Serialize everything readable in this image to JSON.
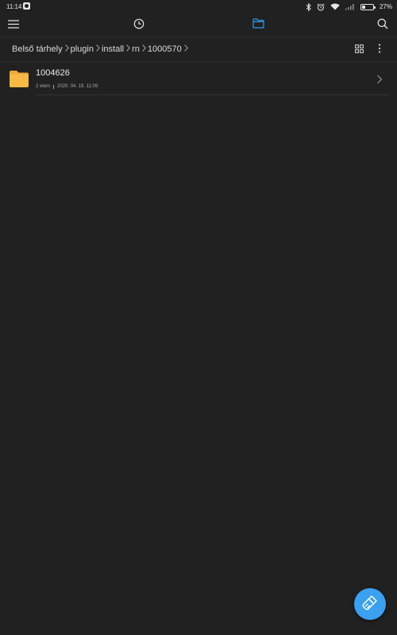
{
  "status_bar": {
    "time": "11:14",
    "battery_percent_text": "27%",
    "battery_level": 0.27
  },
  "toolbar": {
    "active_tab": "files",
    "accent_color": "#2d9cf0"
  },
  "breadcrumb": {
    "items": [
      "Belső tárhely",
      "plugin",
      "install",
      "rn",
      "1000570"
    ]
  },
  "files": [
    {
      "name": "1004626",
      "item_count": "2 elem",
      "modified": "2020. 04. 19. 11:09",
      "icon": "folder-icon"
    }
  ],
  "colors": {
    "background": "#212121",
    "folder": "#f7b944",
    "fab": "#3aa0f2"
  },
  "fab": {
    "icon": "clean-brush-icon"
  }
}
